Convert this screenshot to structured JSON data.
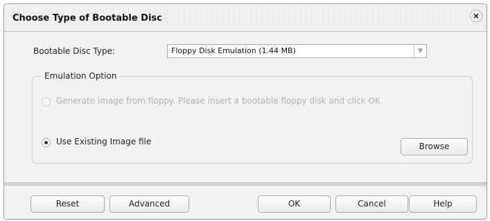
{
  "dialog": {
    "title": "Choose Type of Bootable Disc",
    "close_glyph": "×"
  },
  "disc_type": {
    "label": "Bootable Disc Type:",
    "selected_value": "Floppy Disk Emulation (1.44 MB)",
    "arrow_glyph": "▼"
  },
  "emulation": {
    "legend": "Emulation Option",
    "options": [
      {
        "label": "Generate image from floppy. Please insert a bootable floppy disk and click OK",
        "selected": false,
        "disabled": true
      },
      {
        "label": "Use Existing Image file",
        "selected": true,
        "disabled": false
      }
    ],
    "browse_label": "Browse"
  },
  "footer": {
    "reset_label": "Reset",
    "advanced_label": "Advanced",
    "ok_label": "OK",
    "cancel_label": "Cancel",
    "help_label": "Help"
  }
}
